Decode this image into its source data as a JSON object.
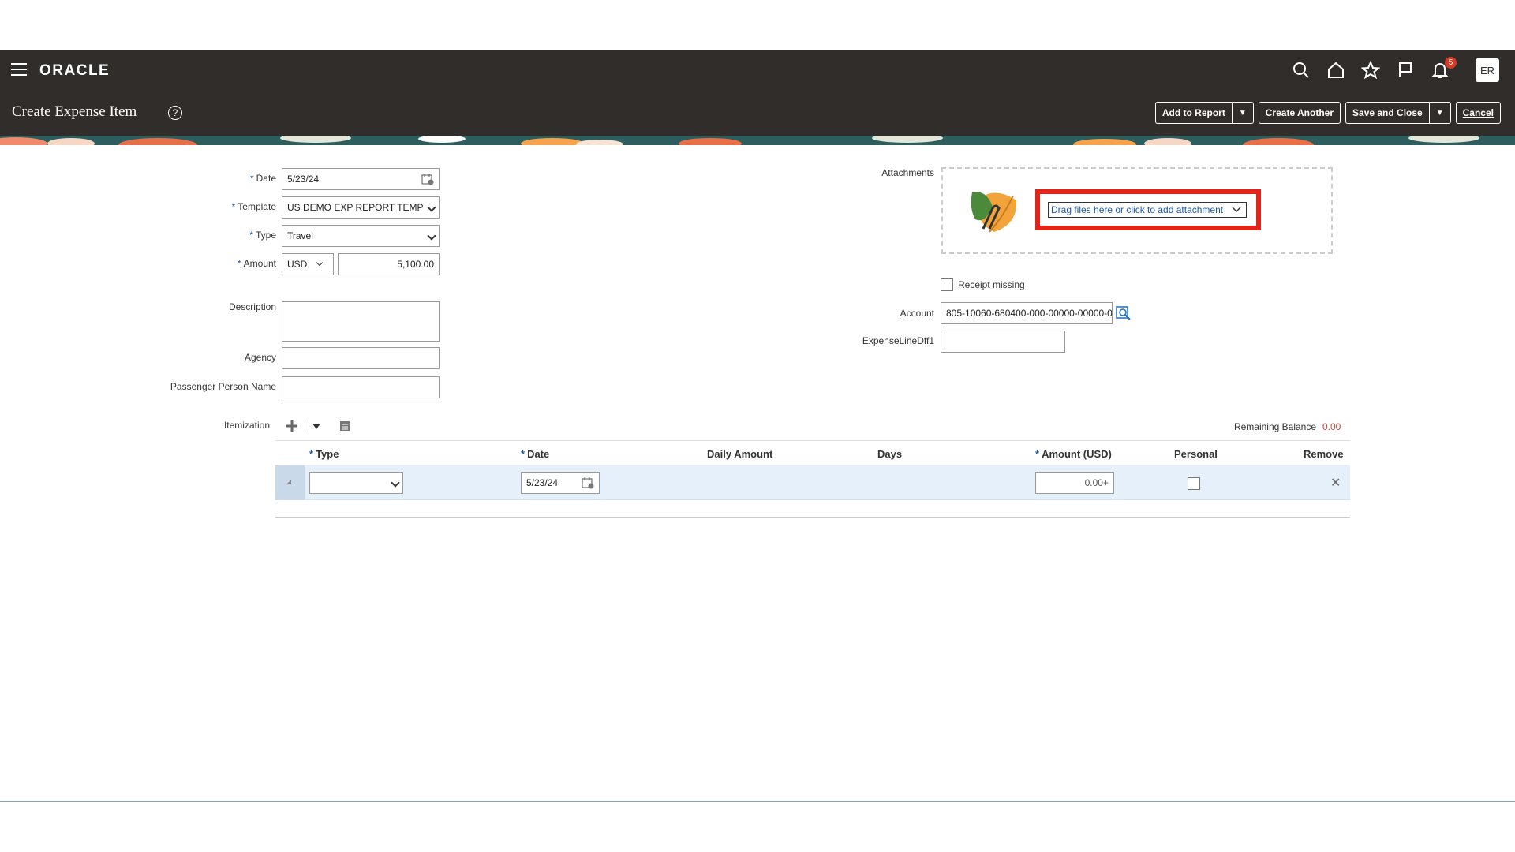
{
  "app": {
    "logo": "ORACLE"
  },
  "header": {
    "notifications_count": "5",
    "user_initials": "ER"
  },
  "titlebar": {
    "title": "Create Expense Item",
    "help": "?"
  },
  "actions": {
    "add_to_report": "Add to Report",
    "create_another": "Create Another",
    "save_and_close": "Save and Close",
    "cancel": "Cancel",
    "dropdown": "▼"
  },
  "form": {
    "date": {
      "label": "Date",
      "value": "5/23/24"
    },
    "template": {
      "label": "Template",
      "value": "US DEMO EXP REPORT TEMPI"
    },
    "type": {
      "label": "Type",
      "value": "Travel"
    },
    "amount": {
      "label": "Amount",
      "currency": "USD",
      "value": "5,100.00"
    },
    "description": {
      "label": "Description",
      "value": ""
    },
    "agency": {
      "label": "Agency",
      "value": ""
    },
    "passenger": {
      "label": "Passenger Person Name",
      "value": ""
    },
    "required_mark": "*"
  },
  "attachments": {
    "label": "Attachments",
    "link_text": "Drag files here or click to add attachment"
  },
  "right_fields": {
    "receipt_missing": "Receipt missing",
    "account": {
      "label": "Account",
      "value": "805-10060-680400-000-00000-00000-0"
    },
    "dff": {
      "label": "ExpenseLineDff1",
      "value": ""
    }
  },
  "itemization": {
    "label": "Itemization",
    "remaining_balance_label": "Remaining Balance",
    "remaining_balance_value": "0.00",
    "columns": {
      "type": "Type",
      "date": "Date",
      "daily_amount": "Daily Amount",
      "days": "Days",
      "amount_usd": "Amount (USD)",
      "personal": "Personal",
      "remove": "Remove"
    },
    "row": {
      "type": "",
      "date": "5/23/24",
      "amount": "0.00+",
      "remove": "✕"
    }
  },
  "colors": {
    "header_bg": "#312d2a",
    "highlight_red": "#e2231a",
    "link_blue": "#1e5aa8",
    "balance_orange": "#c74634"
  }
}
